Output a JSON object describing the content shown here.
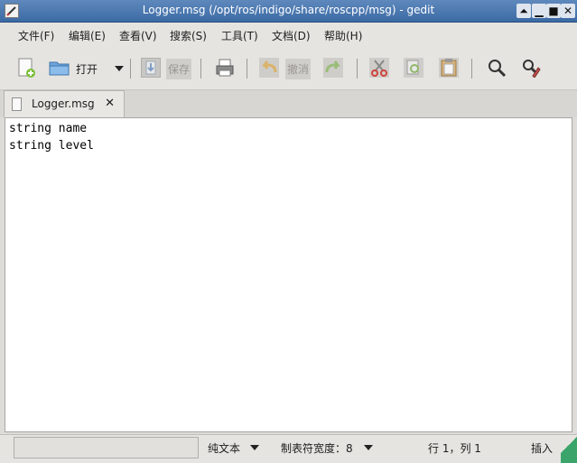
{
  "window": {
    "title": "Logger.msg (/opt/ros/indigo/share/roscpp/msg) - gedit",
    "controls": [
      "⏶",
      "▁",
      "■",
      "✕"
    ]
  },
  "menu": [
    "文件(F)",
    "编辑(E)",
    "查看(V)",
    "搜索(S)",
    "工具(T)",
    "文档(D)",
    "帮助(H)"
  ],
  "toolbar": {
    "open_label": "打开",
    "save_label": "保存",
    "undo_label": "撤消"
  },
  "tab": {
    "label": "Logger.msg",
    "close": "✕"
  },
  "editor": {
    "lines": [
      "string name",
      "string level"
    ]
  },
  "status": {
    "message": "",
    "language": "纯文本",
    "tab_width": "制表符宽度：8",
    "position": "行 1，列 1",
    "mode": "插入"
  }
}
